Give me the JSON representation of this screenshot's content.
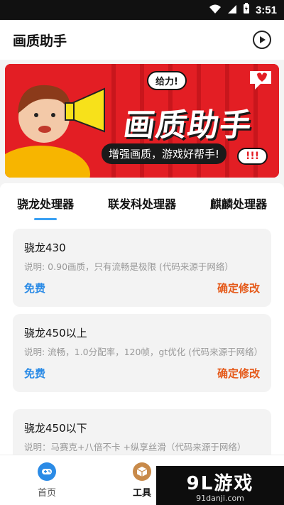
{
  "status": {
    "time": "3:51"
  },
  "appbar": {
    "title": "画质助手"
  },
  "banner": {
    "bubble": "给力!",
    "title": "画质助手",
    "subtitle": "增强画质，游戏好帮手!",
    "bubble2": "!!!"
  },
  "tabs": [
    {
      "label": "骁龙处理器"
    },
    {
      "label": "联发科处理器"
    },
    {
      "label": "麒麟处理器"
    }
  ],
  "cards": [
    {
      "name": "骁龙430",
      "desc": "说明: 0.90画质，只有流畅是极限 (代码来源于网络）",
      "free": "免费",
      "confirm": "确定修改"
    },
    {
      "name": "骁龙450以上",
      "desc": "说明: 流畅，1.0分配率，120帧，gt优化 (代码来源于网络）",
      "free": "免费",
      "confirm": "确定修改"
    },
    {
      "name": "骁龙450以下",
      "desc": "说明：马赛克+八倍不卡 +纵享丝滑（代码来源于网络）",
      "free": "",
      "confirm": ""
    }
  ],
  "nav": [
    {
      "label": "首页",
      "icon": "gamepad-icon",
      "color": "#2b8be6"
    },
    {
      "label": "工具",
      "icon": "box-icon",
      "color": "#c88a4a"
    }
  ],
  "watermark": {
    "top": "9L游戏",
    "bottom": "91danji.com"
  }
}
